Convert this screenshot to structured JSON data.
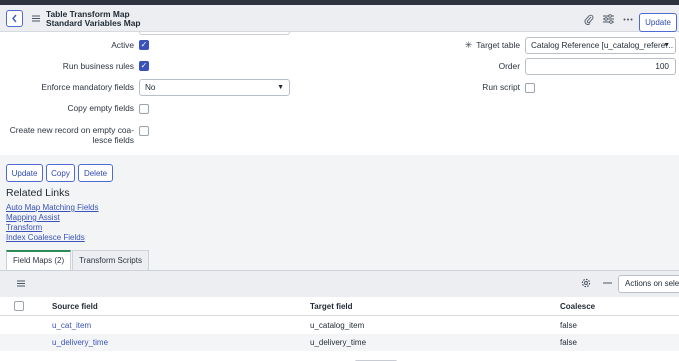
{
  "header": {
    "title_line1": "Table Transform Map",
    "title_line2": "Standard Variables Map",
    "update_label": "Update"
  },
  "form": {
    "active_label": "Active",
    "active_checked": true,
    "run_business_rules_label": "Run business rules",
    "run_business_rules_checked": true,
    "enforce_mandatory_label": "Enforce mandatory fields",
    "enforce_mandatory_value": "No",
    "copy_empty_label": "Copy empty fields",
    "copy_empty_checked": false,
    "create_new_label_line1": "Create new record on empty coa-",
    "create_new_label_line2": "lesce fields",
    "create_new_checked": false,
    "target_table_label": "Target table",
    "target_table_value": "Catalog Reference [u_catalog_refere…",
    "order_label": "Order",
    "order_value": "100",
    "run_script_label": "Run script",
    "run_script_checked": false
  },
  "buttons": {
    "update": "Update",
    "copy": "Copy",
    "delete": "Delete"
  },
  "related": {
    "title": "Related Links",
    "links": [
      "Auto Map Matching Fields",
      "Mapping Assist",
      "Transform",
      "Index Coalesce Fields"
    ]
  },
  "tabs": [
    {
      "label": "Field Maps (2)",
      "active": true
    },
    {
      "label": "Transform Scripts",
      "active": false
    }
  ],
  "list": {
    "actions_placeholder": "Actions on selec",
    "columns": [
      "Source field",
      "Target field",
      "Coalesce"
    ],
    "rows": [
      [
        "u_cat_item",
        "u_catalog_item",
        "false"
      ],
      [
        "u_delivery_time",
        "u_delivery_time",
        "false"
      ]
    ]
  },
  "colors": {
    "accent": "#3953b8",
    "active_tab": "#2e8b57",
    "header_bg": "#eceef1"
  }
}
